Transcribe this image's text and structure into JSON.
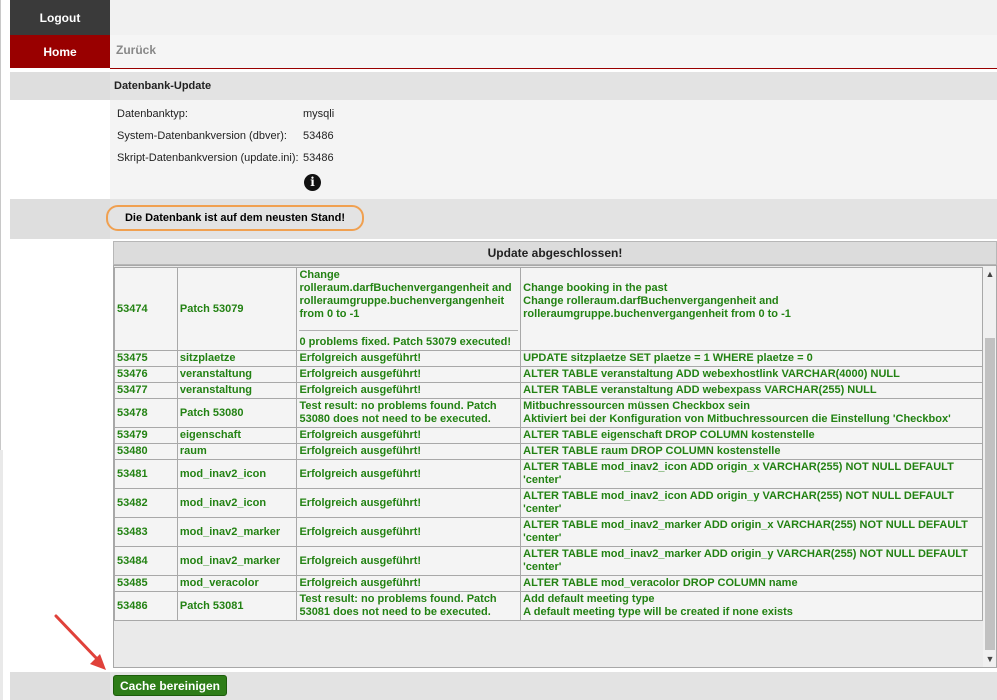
{
  "nav": {
    "logout": "Logout",
    "home": "Home",
    "back": "Zurück"
  },
  "section": {
    "title": "Datenbank-Update"
  },
  "info": {
    "rows": [
      {
        "label": "Datenbanktyp:",
        "value": "mysqli"
      },
      {
        "label": "System-Datenbankversion (dbver):",
        "value": "53486"
      },
      {
        "label": "Skript-Datenbankversion (update.ini):",
        "value": "53486"
      }
    ],
    "icon": "info-icon"
  },
  "status": {
    "message": "Die Datenbank ist auf dem neusten Stand!"
  },
  "update": {
    "header": "Update abgeschlossen!",
    "first": {
      "id": "53474",
      "name": "Patch 53079",
      "result_top": "Change rolleraum.darfBuchenvergangenheit and rolleraumgruppe.buchenvergangenheit from 0 to -1",
      "result_bottom": "0 problems fixed. Patch 53079 executed!",
      "sql_line1": "Change booking in the past",
      "sql_line2": "Change rolleraum.darfBuchenvergangenheit and rolleraumgruppe.buchenvergangenheit from 0 to -1"
    },
    "rows": [
      {
        "id": "53475",
        "name": "sitzplaetze",
        "result": "Erfolgreich ausgeführt!",
        "sql": "UPDATE sitzplaetze SET plaetze = 1 WHERE plaetze = 0"
      },
      {
        "id": "53476",
        "name": "veranstaltung",
        "result": "Erfolgreich ausgeführt!",
        "sql": "ALTER TABLE veranstaltung ADD webexhostlink VARCHAR(4000) NULL"
      },
      {
        "id": "53477",
        "name": "veranstaltung",
        "result": "Erfolgreich ausgeführt!",
        "sql": "ALTER TABLE veranstaltung ADD webexpass VARCHAR(255) NULL"
      },
      {
        "id": "53478",
        "name": "Patch 53080",
        "result": "Test result: no problems found. Patch 53080 does not need to be executed.",
        "sql": "Mitbuchressourcen müssen Checkbox sein",
        "sql2": "Aktiviert bei der Konfiguration von Mitbuchressourcen die Einstellung 'Checkbox'"
      },
      {
        "id": "53479",
        "name": "eigenschaft",
        "result": "Erfolgreich ausgeführt!",
        "sql": "ALTER TABLE eigenschaft DROP COLUMN kostenstelle"
      },
      {
        "id": "53480",
        "name": "raum",
        "result": "Erfolgreich ausgeführt!",
        "sql": "ALTER TABLE raum DROP COLUMN kostenstelle"
      },
      {
        "id": "53481",
        "name": "mod_inav2_icon",
        "result": "Erfolgreich ausgeführt!",
        "sql": "ALTER TABLE mod_inav2_icon ADD origin_x VARCHAR(255) NOT NULL DEFAULT 'center'"
      },
      {
        "id": "53482",
        "name": "mod_inav2_icon",
        "result": "Erfolgreich ausgeführt!",
        "sql": "ALTER TABLE mod_inav2_icon ADD origin_y VARCHAR(255) NOT NULL DEFAULT 'center'"
      },
      {
        "id": "53483",
        "name": "mod_inav2_marker",
        "result": "Erfolgreich ausgeführt!",
        "sql": "ALTER TABLE mod_inav2_marker ADD origin_x VARCHAR(255) NOT NULL DEFAULT 'center'"
      },
      {
        "id": "53484",
        "name": "mod_inav2_marker",
        "result": "Erfolgreich ausgeführt!",
        "sql": "ALTER TABLE mod_inav2_marker ADD origin_y VARCHAR(255) NOT NULL DEFAULT 'center'"
      },
      {
        "id": "53485",
        "name": "mod_veracolor",
        "result": "Erfolgreich ausgeführt!",
        "sql": "ALTER TABLE mod_veracolor DROP COLUMN name"
      },
      {
        "id": "53486",
        "name": "Patch 53081",
        "result": "Test result: no problems found. Patch 53081 does not need to be executed.",
        "sql": "Add default meeting type",
        "sql2": "A default meeting type will be created if none exists"
      }
    ]
  },
  "actions": {
    "cache_button": "Cache bereinigen"
  },
  "colors": {
    "home_red": "#990000",
    "logout_dark": "#3a3a3a",
    "result_green": "#238213",
    "button_green": "#2e7d18",
    "highlight_orange": "#f0a050",
    "arrow_red": "#e0413a"
  }
}
